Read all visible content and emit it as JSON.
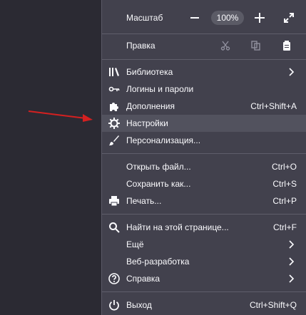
{
  "zoom": {
    "label": "Масштаб",
    "value": "100%",
    "minus_icon": "minus-icon",
    "plus_icon": "plus-icon",
    "fullscreen_icon": "fullscreen-icon"
  },
  "edit": {
    "label": "Правка",
    "cut_icon": "scissors-icon",
    "copy_icon": "copy-icon",
    "paste_icon": "clipboard-icon"
  },
  "items": {
    "library": {
      "label": "Библиотека"
    },
    "logins": {
      "label": "Логины и пароли"
    },
    "addons": {
      "label": "Дополнения",
      "shortcut": "Ctrl+Shift+A"
    },
    "settings": {
      "label": "Настройки"
    },
    "customize": {
      "label": "Персонализация..."
    },
    "open_file": {
      "label": "Открыть файл...",
      "shortcut": "Ctrl+O"
    },
    "save_as": {
      "label": "Сохранить как...",
      "shortcut": "Ctrl+S"
    },
    "print": {
      "label": "Печать...",
      "shortcut": "Ctrl+P"
    },
    "find": {
      "label": "Найти на этой странице...",
      "shortcut": "Ctrl+F"
    },
    "more": {
      "label": "Ещё"
    },
    "devtools": {
      "label": "Веб-разработка"
    },
    "help": {
      "label": "Справка"
    },
    "exit": {
      "label": "Выход",
      "shortcut": "Ctrl+Shift+Q"
    }
  },
  "colors": {
    "menu_bg": "#42414d",
    "highlight": "#52525e",
    "arrow": "#e02020"
  }
}
